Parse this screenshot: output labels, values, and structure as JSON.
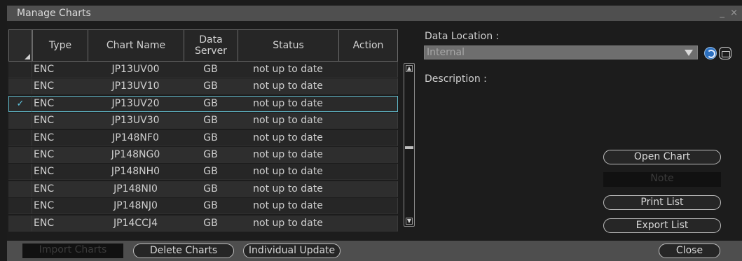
{
  "window": {
    "title": "Manage Charts",
    "controls": "_ ×"
  },
  "table": {
    "headers": {
      "type": "Type",
      "chart_name": "Chart Name",
      "data_server": "Data Server",
      "status": "Status",
      "action": "Action"
    },
    "rows": [
      {
        "type": "ENC",
        "chart_name": "JP13UV00",
        "data_server": "GB",
        "status": "not up to date",
        "action": "",
        "selected": false
      },
      {
        "type": "ENC",
        "chart_name": "JP13UV10",
        "data_server": "GB",
        "status": "not up to date",
        "action": "",
        "selected": false
      },
      {
        "type": "ENC",
        "chart_name": "JP13UV20",
        "data_server": "GB",
        "status": "not up to date",
        "action": "",
        "selected": true
      },
      {
        "type": "ENC",
        "chart_name": "JP13UV30",
        "data_server": "GB",
        "status": "not up to date",
        "action": "",
        "selected": false
      },
      {
        "type": "ENC",
        "chart_name": "JP148NF0",
        "data_server": "GB",
        "status": "not up to date",
        "action": "",
        "selected": false
      },
      {
        "type": "ENC",
        "chart_name": "JP148NG0",
        "data_server": "GB",
        "status": "not up to date",
        "action": "",
        "selected": false
      },
      {
        "type": "ENC",
        "chart_name": "JP148NH0",
        "data_server": "GB",
        "status": "not up to date",
        "action": "",
        "selected": false
      },
      {
        "type": "ENC",
        "chart_name": "JP148NI0",
        "data_server": "GB",
        "status": "not up to date",
        "action": "",
        "selected": false
      },
      {
        "type": "ENC",
        "chart_name": "JP148NJ0",
        "data_server": "GB",
        "status": "not up to date",
        "action": "",
        "selected": false
      },
      {
        "type": "ENC",
        "chart_name": "JP14CCJ4",
        "data_server": "GB",
        "status": "not up to date",
        "action": "",
        "selected": false
      }
    ],
    "check_glyph": "✓"
  },
  "panel": {
    "data_location_label": "Data Location :",
    "data_location_value": "Internal",
    "description_label": "Description :",
    "open_chart": "Open Chart",
    "note": "Note",
    "print_list": "Print List",
    "export_list": "Export List"
  },
  "bottom": {
    "import_charts": "Import Charts",
    "delete_charts": "Delete Charts",
    "individual_update": "Individual Update",
    "close": "Close"
  },
  "icons": {
    "refresh": "refresh-icon",
    "folder": "folder-icon",
    "dropdown": "chevron-down-icon"
  },
  "colors": {
    "selection_border": "#5fb7c7",
    "check": "#5fc3dc",
    "title_bar": "#4f4f4f"
  }
}
